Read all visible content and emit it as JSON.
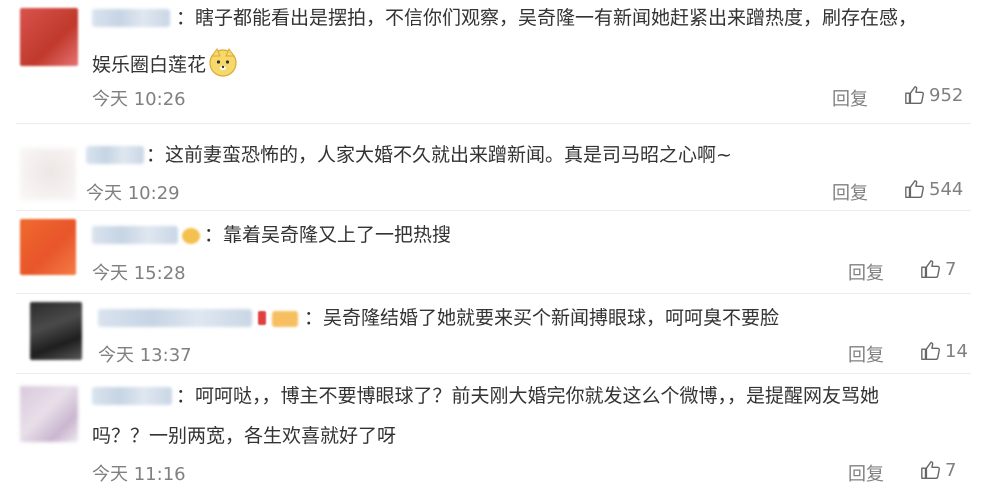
{
  "comments": [
    {
      "text_line1": "：瞎子都能看出是摆拍，不信你们观察，吴奇隆一有新闻她赶紧出来蹭热度，刷存在感，",
      "text_line2": "娱乐圈白莲花",
      "emoji": "doge-emoji",
      "time": "今天 10:26",
      "reply": "回复",
      "likes": "952"
    },
    {
      "text_line1": "：这前妻蛮恐怖的，人家大婚不久就出来蹭新闻。真是司马昭之心啊~",
      "time": "今天 10:29",
      "reply": "回复",
      "likes": "544"
    },
    {
      "text_line1": "：靠着吴奇隆又上了一把热搜",
      "time": "今天 15:28",
      "reply": "回复",
      "likes": "7"
    },
    {
      "text_line1": "：吴奇隆结婚了她就要来买个新闻搏眼球，呵呵臭不要脸",
      "time": "今天 13:37",
      "reply": "回复",
      "likes": "14"
    },
    {
      "text_line1": "：呵呵哒，，博主不要博眼球了？前夫刚大婚完你就发这么个微博，，是提醒网友骂她",
      "text_line2": "吗？？一别两宽，各生欢喜就好了呀",
      "time": "今天 11:16",
      "reply": "回复",
      "likes": "7"
    }
  ],
  "colors": {
    "username_blur": "#c9d6e5",
    "text": "#333333",
    "meta": "#808080",
    "separator": "#ececec"
  },
  "icons": [
    "thumbs-up-icon",
    "doge-emoji"
  ]
}
